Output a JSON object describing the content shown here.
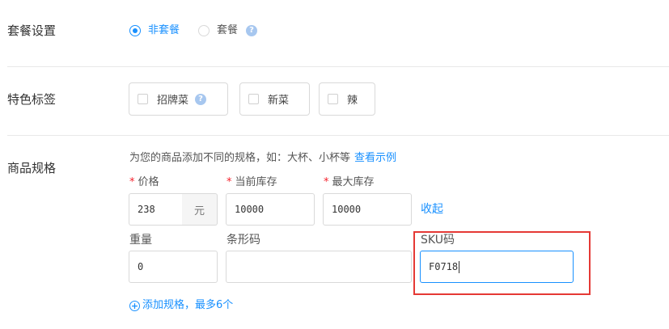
{
  "package": {
    "label": "套餐设置",
    "options": [
      {
        "label": "非套餐",
        "checked": true
      },
      {
        "label": "套餐",
        "checked": false
      }
    ],
    "help_glyph": "?"
  },
  "tags": {
    "label": "特色标签",
    "items": [
      {
        "label": "招牌菜",
        "help": "?"
      },
      {
        "label": "新菜"
      },
      {
        "label": "辣"
      }
    ]
  },
  "specs": {
    "label": "商品规格",
    "hint": "为您的商品添加不同的规格，如：大杯、小杯等",
    "hint_link": "查看示例",
    "price_label": "价格",
    "price_value": "238",
    "price_unit": "元",
    "stock_label": "当前库存",
    "stock_value": "10000",
    "max_stock_label": "最大库存",
    "max_stock_value": "10000",
    "required_mark": "*",
    "collapse_label": "收起",
    "weight_label": "重量",
    "weight_value": "0",
    "barcode_label": "条形码",
    "barcode_value": "",
    "sku_label": "SKU码",
    "sku_value": "F0718",
    "add_label": "添加规格，最多6个",
    "add_glyph": "+"
  },
  "colors": {
    "accent": "#1890ff",
    "required": "#f5222d",
    "highlight": "#e53935"
  }
}
